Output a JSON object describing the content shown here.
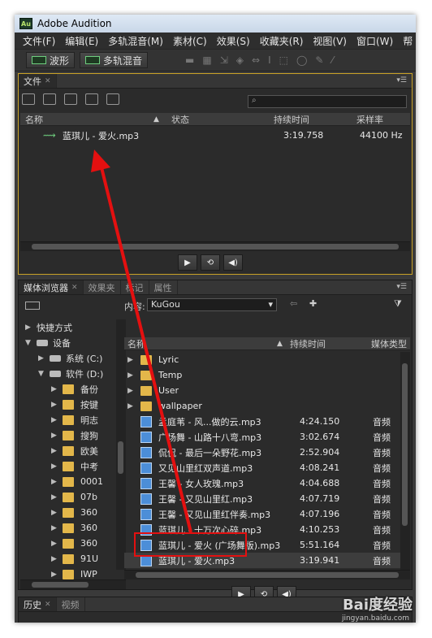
{
  "window": {
    "app_icon": "Au",
    "title": "Adobe Audition"
  },
  "menubar": [
    "文件(F)",
    "编辑(E)",
    "多轨混音(M)",
    "素材(C)",
    "效果(S)",
    "收藏夹(R)",
    "视图(V)",
    "窗口(W)",
    "帮"
  ],
  "toolbar": {
    "waveform_label": "波形",
    "multitrack_label": "多轨混音"
  },
  "files_panel": {
    "tab": "文件",
    "search_placeholder": "",
    "columns": {
      "name": "名称",
      "status": "状态",
      "duration": "持续时间",
      "sample_rate": "采样率"
    },
    "rows": [
      {
        "name": "蓝琪儿 - 爱火.mp3",
        "duration": "3:19.758",
        "sample_rate": "44100 Hz"
      }
    ]
  },
  "browser_panel": {
    "tabs": [
      "媒体浏览器",
      "效果夹",
      "标记",
      "属性"
    ],
    "contents_label": "内容:",
    "location": "KuGou",
    "columns": {
      "name": "名称",
      "duration": "持续时间",
      "media_type": "媒体类型"
    },
    "tree": [
      {
        "label": "快捷方式",
        "level": 0,
        "kind": "arrow"
      },
      {
        "label": "设备",
        "level": 0,
        "kind": "device"
      },
      {
        "label": "系统 (C:)",
        "level": 1,
        "kind": "drive"
      },
      {
        "label": "软件 (D:)",
        "level": 1,
        "kind": "drive"
      },
      {
        "label": "备份",
        "level": 2,
        "kind": "folder"
      },
      {
        "label": "按键",
        "level": 2,
        "kind": "folder"
      },
      {
        "label": "明志",
        "level": 2,
        "kind": "folder"
      },
      {
        "label": "搜狗",
        "level": 2,
        "kind": "folder"
      },
      {
        "label": "欧美",
        "level": 2,
        "kind": "folder"
      },
      {
        "label": "中考",
        "level": 2,
        "kind": "folder"
      },
      {
        "label": "0001",
        "level": 2,
        "kind": "folder"
      },
      {
        "label": "07b",
        "level": 2,
        "kind": "folder"
      },
      {
        "label": "360",
        "level": 2,
        "kind": "folder"
      },
      {
        "label": "360",
        "level": 2,
        "kind": "folder"
      },
      {
        "label": "360",
        "level": 2,
        "kind": "folder"
      },
      {
        "label": "91U",
        "level": 2,
        "kind": "folder"
      },
      {
        "label": "IWP",
        "level": 2,
        "kind": "folder"
      }
    ],
    "files": [
      {
        "name": "Lyric",
        "duration": "",
        "type": "",
        "kind": "folder"
      },
      {
        "name": "Temp",
        "duration": "",
        "type": "",
        "kind": "folder"
      },
      {
        "name": "User",
        "duration": "",
        "type": "",
        "kind": "folder"
      },
      {
        "name": "wallpaper",
        "duration": "",
        "type": "",
        "kind": "folder"
      },
      {
        "name": "孟庭苇 - 风...做的云.mp3",
        "duration": "4:24.150",
        "type": "音频",
        "kind": "file"
      },
      {
        "name": "广场舞 - 山路十八弯.mp3",
        "duration": "3:02.674",
        "type": "音频",
        "kind": "file"
      },
      {
        "name": "侃侃 - 最后一朵野花.mp3",
        "duration": "2:52.904",
        "type": "音频",
        "kind": "file"
      },
      {
        "name": "又见山里红双声道.mp3",
        "duration": "4:08.241",
        "type": "音频",
        "kind": "file"
      },
      {
        "name": "王馨 - 女人玫瑰.mp3",
        "duration": "4:04.688",
        "type": "音频",
        "kind": "file"
      },
      {
        "name": "王馨 - 又见山里红.mp3",
        "duration": "4:07.719",
        "type": "音频",
        "kind": "file"
      },
      {
        "name": "王馨 - 又见山里红伴奏.mp3",
        "duration": "4:07.196",
        "type": "音频",
        "kind": "file"
      },
      {
        "name": "蓝琪儿 - 十万次心碎.mp3",
        "duration": "4:10.253",
        "type": "音频",
        "kind": "file"
      },
      {
        "name": "蓝琪儿 - 爱火 (广场舞版).mp3",
        "duration": "5:51.164",
        "type": "音频",
        "kind": "file"
      },
      {
        "name": "蓝琪儿 - 爱火.mp3",
        "duration": "3:19.941",
        "type": "音频",
        "kind": "file"
      }
    ]
  },
  "bottom_panel": {
    "tabs": [
      "历史",
      "视频"
    ]
  },
  "watermark": {
    "brand": "Bai度经验",
    "url": "jingyan.baidu.com"
  },
  "colors": {
    "highlight": "#e41010",
    "accent_green": "#6fcf7f"
  }
}
